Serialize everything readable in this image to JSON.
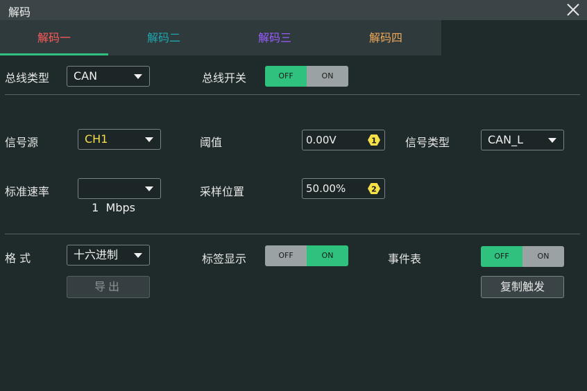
{
  "window": {
    "title": "解码"
  },
  "tabs": [
    {
      "label": "解码一",
      "color": "#ff5a5a"
    },
    {
      "label": "解码二",
      "color": "#1ea8b0"
    },
    {
      "label": "解码三",
      "color": "#9a5cff"
    },
    {
      "label": "解码四",
      "color": "#f0a85a"
    }
  ],
  "bus": {
    "type_label": "总线类型",
    "type_value": "CAN",
    "switch_label": "总线开关",
    "switch_off": "OFF",
    "switch_on": "ON",
    "switch_state": "OFF"
  },
  "signal": {
    "source_label": "信号源",
    "source_value": "CH1",
    "source_color": "#f5e04a",
    "threshold_label": "阈值",
    "threshold_value": "0.00V",
    "threshold_knob": "1",
    "signal_type_label": "信号类型",
    "signal_type_value": "CAN_L",
    "rate_label": "标准速率",
    "rate_value": "1  Mbps",
    "sample_label": "采样位置",
    "sample_value": "50.00%",
    "sample_knob": "2"
  },
  "display": {
    "format_label": "格 式",
    "format_value": "十六进制",
    "tag_label": "标签显示",
    "tag_off": "OFF",
    "tag_on": "ON",
    "tag_state": "ON",
    "event_label": "事件表",
    "event_off": "OFF",
    "event_on": "ON",
    "event_state": "OFF",
    "export_label": "导出",
    "copy_trigger_label": "复制触发"
  },
  "colors": {
    "toggle_active": "#2ec27e",
    "toggle_inactive": "#9aa2a4",
    "knob": "#f5e04a"
  }
}
